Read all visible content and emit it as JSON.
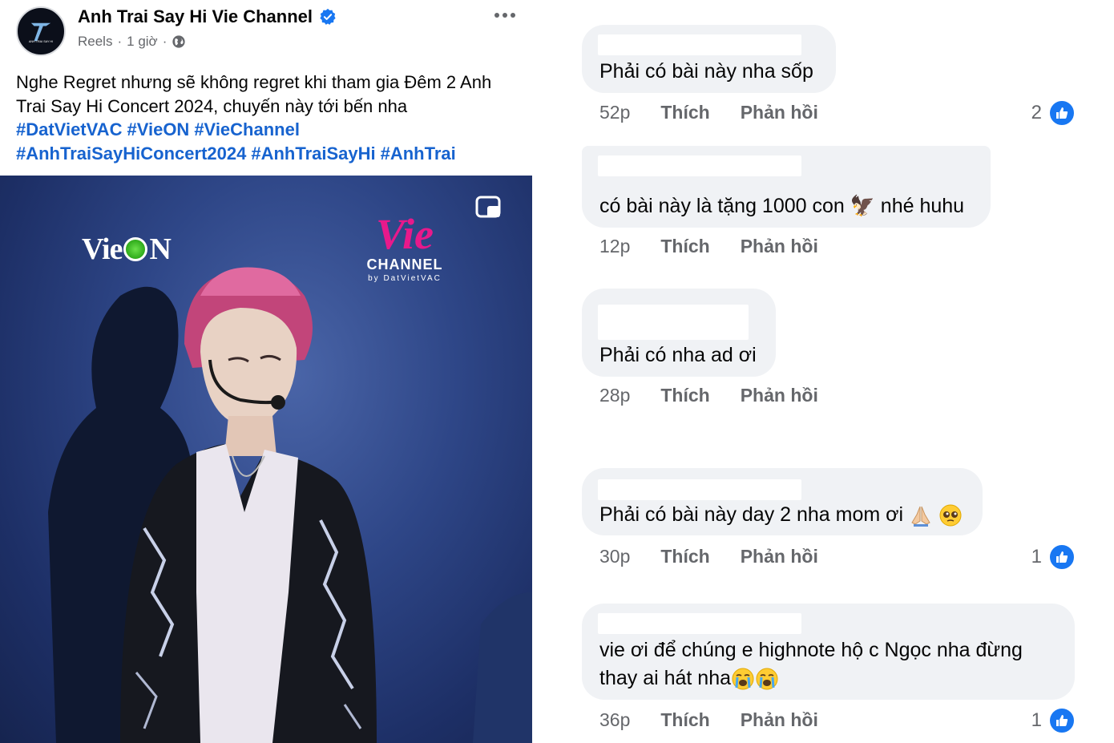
{
  "post": {
    "page_name": "Anh Trai Say Hi Vie Channel",
    "avatar_text": "ANH TRAI SAY HI",
    "meta_type": "Reels",
    "meta_sep1": "·",
    "meta_time": "1 giờ",
    "meta_sep2": "·",
    "caption": "Nghe Regret nhưng sẽ không regret khi tham gia Đêm 2 Anh Trai Say Hi Concert 2024, chuyến này tới bến nha",
    "hashtags": [
      "#DatVietVAC",
      "#VieON",
      "#VieChannel",
      "#AnhTraiSayHiConcert2024",
      "#AnhTraiSayHi",
      "#AnhTrai"
    ],
    "video": {
      "logo_left_a": "Vie",
      "logo_left_b": "N",
      "logo_right_main": "Vie",
      "logo_right_sub": "CHANNEL",
      "logo_right_by": "by DatVietVAC"
    }
  },
  "comments": [
    {
      "text": "Phải có bài này nha sốp",
      "time": "52p",
      "like": "Thích",
      "reply": "Phản hồi",
      "reactions": "2"
    },
    {
      "text": "có bài này là tặng 1000 con 🦅 nhé huhu",
      "time": "12p",
      "like": "Thích",
      "reply": "Phản hồi",
      "reactions": ""
    },
    {
      "text": "Phải có nha ad ơi",
      "time": "28p",
      "like": "Thích",
      "reply": "Phản hồi",
      "reactions": ""
    },
    {
      "text": "Phải có bài này day 2 nha mom ơi",
      "time": "30p",
      "like": "Thích",
      "reply": "Phản hồi",
      "reactions": "1"
    },
    {
      "text_line1": "vie ơi để chúng e highnote hộ c Ngọc nha đừng",
      "text_line2": "thay ai hát nha",
      "time": "36p",
      "like": "Thích",
      "reply": "Phản hồi",
      "reactions": "1"
    }
  ],
  "colors": {
    "link": "#1763cf",
    "bubble": "#f0f2f5",
    "secondary": "#65676b",
    "like": "#1877f2"
  }
}
